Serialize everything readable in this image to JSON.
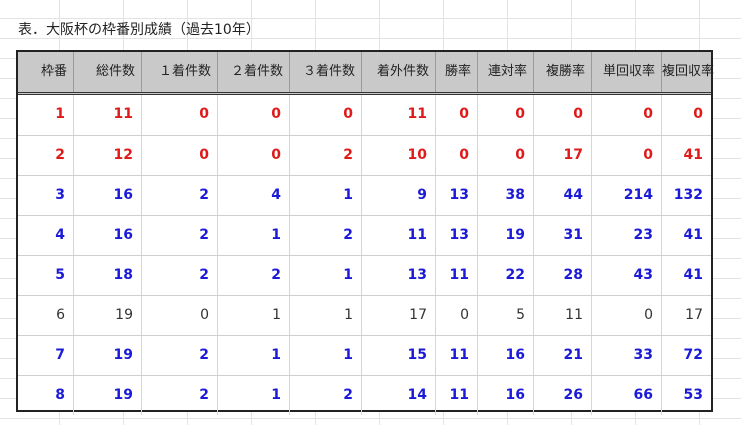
{
  "caption": "表．大阪杯の枠番別成績（過去10年）",
  "table": {
    "headers": [
      "枠番",
      "総件数",
      "１着件数",
      "２着件数",
      "３着件数",
      "着外件数",
      "勝率",
      "連対率",
      "複勝率",
      "単回収率",
      "複回収率"
    ],
    "rows": [
      {
        "style": "red",
        "cells": [
          "1",
          "11",
          "0",
          "0",
          "0",
          "11",
          "0",
          "0",
          "0",
          "0",
          "0"
        ]
      },
      {
        "style": "red",
        "cells": [
          "2",
          "12",
          "0",
          "0",
          "2",
          "10",
          "0",
          "0",
          "17",
          "0",
          "41"
        ]
      },
      {
        "style": "blue",
        "cells": [
          "3",
          "16",
          "2",
          "4",
          "1",
          "9",
          "13",
          "38",
          "44",
          "214",
          "132"
        ]
      },
      {
        "style": "blue",
        "cells": [
          "4",
          "16",
          "2",
          "1",
          "2",
          "11",
          "13",
          "19",
          "31",
          "23",
          "41"
        ]
      },
      {
        "style": "blue",
        "cells": [
          "5",
          "18",
          "2",
          "2",
          "1",
          "13",
          "11",
          "22",
          "28",
          "43",
          "41"
        ]
      },
      {
        "style": "plain",
        "cells": [
          "6",
          "19",
          "0",
          "1",
          "1",
          "17",
          "0",
          "5",
          "11",
          "0",
          "17"
        ]
      },
      {
        "style": "blue",
        "cells": [
          "7",
          "19",
          "2",
          "1",
          "1",
          "15",
          "11",
          "16",
          "21",
          "33",
          "72"
        ]
      },
      {
        "style": "blue",
        "cells": [
          "8",
          "19",
          "2",
          "1",
          "2",
          "14",
          "11",
          "16",
          "26",
          "66",
          "53"
        ]
      }
    ]
  },
  "colors": {
    "header_bg": "#c9c9c9",
    "highlight_red": "#e01a1a",
    "highlight_blue": "#1a1ad8",
    "plain_text": "#333333"
  }
}
